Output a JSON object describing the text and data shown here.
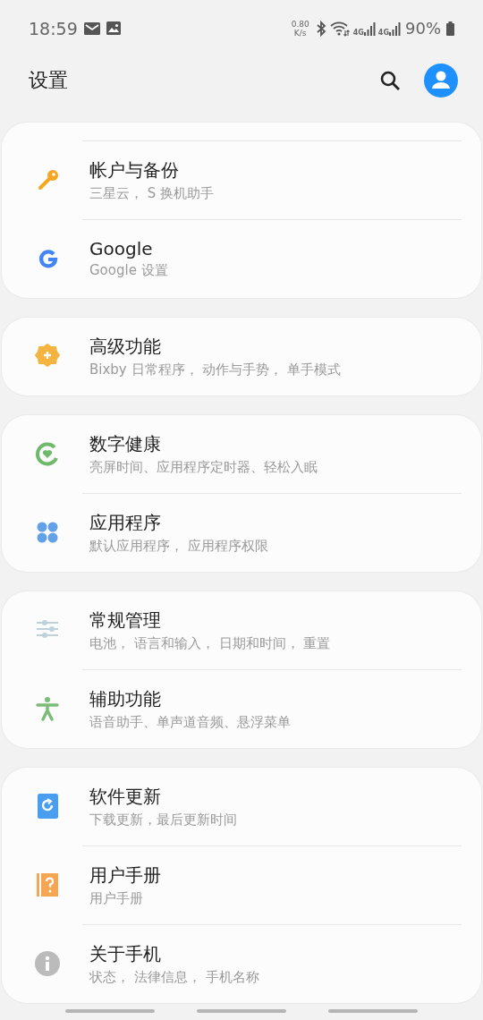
{
  "status_bar": {
    "time": "18:59",
    "net_speed": "0.80",
    "net_unit": "K/s",
    "networks": [
      "4G",
      "4G"
    ],
    "battery": "90%"
  },
  "header": {
    "title": "设置"
  },
  "groups": [
    {
      "clipped_top": true,
      "items": [
        {
          "kind": "key",
          "title": "帐户与备份",
          "subtitle": "三星云， S 换机助手"
        },
        {
          "kind": "google",
          "title": "Google",
          "subtitle": "Google 设置"
        }
      ]
    },
    {
      "clipped_top": false,
      "items": [
        {
          "kind": "advanced",
          "title": "高级功能",
          "subtitle": "Bixby 日常程序， 动作与手势， 单手模式"
        }
      ]
    },
    {
      "clipped_top": false,
      "items": [
        {
          "kind": "wellbeing",
          "title": "数字健康",
          "subtitle": "亮屏时间、应用程序定时器、轻松入眠"
        },
        {
          "kind": "apps",
          "title": "应用程序",
          "subtitle": "默认应用程序， 应用程序权限"
        }
      ]
    },
    {
      "clipped_top": false,
      "items": [
        {
          "kind": "general",
          "title": "常规管理",
          "subtitle": "电池， 语言和输入， 日期和时间， 重置"
        },
        {
          "kind": "accessibility",
          "title": "辅助功能",
          "subtitle": "语音助手、单声道音频、悬浮菜单"
        }
      ]
    },
    {
      "clipped_top": false,
      "items": [
        {
          "kind": "update",
          "title": "软件更新",
          "subtitle": "下载更新，最后更新时间"
        },
        {
          "kind": "manual",
          "title": "用户手册",
          "subtitle": "用户手册"
        },
        {
          "kind": "about",
          "title": "关于手机",
          "subtitle": "状态， 法律信息， 手机名称"
        }
      ]
    }
  ]
}
